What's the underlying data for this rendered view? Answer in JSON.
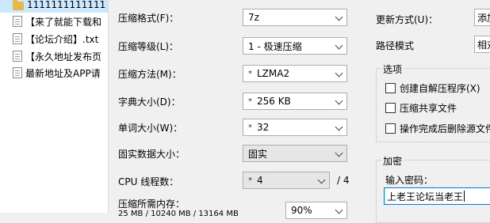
{
  "files": [
    {
      "name": "1111111111111",
      "type": "folder",
      "selected": true
    },
    {
      "name": "【来了就能下载和",
      "type": "file"
    },
    {
      "name": "【论坛介绍】.txt",
      "type": "file"
    },
    {
      "name": "【永久地址发布页",
      "type": "file"
    },
    {
      "name": "最新地址及APP请",
      "type": "file"
    }
  ],
  "settings": {
    "format_label": "压缩格式(F)：",
    "format_value": "7z",
    "level_label": "压缩等级(L)：",
    "level_value": "1 - 极速压缩",
    "method_label": "压缩方法(M)：",
    "method_value": "LZMA2",
    "dict_label": "字典大小(D)：",
    "dict_value": "256 KB",
    "word_label": "单词大小(W)：",
    "word_value": "32",
    "solid_label": "固实数据大小：",
    "solid_value": "固实",
    "cpu_label": "CPU 线程数：",
    "cpu_value": "4",
    "cpu_total": "/ 4",
    "mem_label": "压缩所需内存：",
    "mem_value_line": "25 MB / 10240 MB / 13164 MB",
    "mem_percent": "90%"
  },
  "right": {
    "update_label": "更新方式(U)：",
    "update_value": "添加",
    "path_label": "路径模式",
    "path_value": "相对",
    "options_title": "选项",
    "opt_sfx": "创建自解压程序(X)",
    "opt_shared": "压缩共享文件",
    "opt_delete": "操作完成后删除源文件",
    "encrypt_title": "加密",
    "password_label": "输入密码：",
    "password_value": "上老王论坛当老王"
  }
}
